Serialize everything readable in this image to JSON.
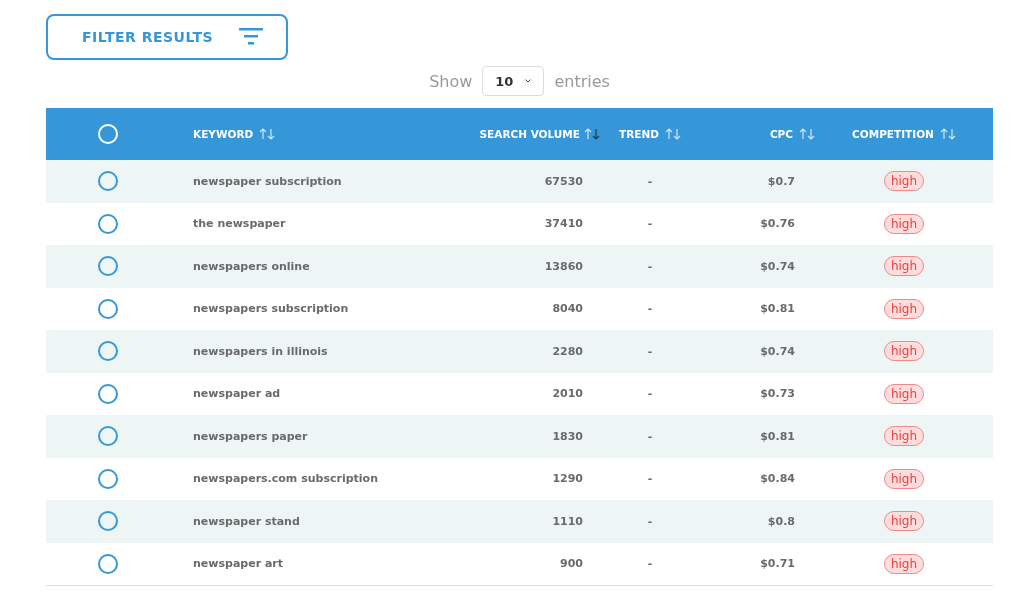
{
  "filter_button": {
    "label": "FILTER RESULTS"
  },
  "entries": {
    "prefix": "Show",
    "value": "10",
    "suffix": "entries"
  },
  "table": {
    "select_all": {
      "checked": false
    },
    "columns": [
      {
        "label": "KEYWORD",
        "sorted": false
      },
      {
        "label": "SEARCH VOLUME",
        "sorted": true
      },
      {
        "label": "TREND",
        "sorted": false
      },
      {
        "label": "CPC",
        "sorted": false
      },
      {
        "label": "COMPETITION",
        "sorted": false
      }
    ],
    "rows": [
      {
        "checked": false,
        "keyword": "newspaper subscription",
        "volume": "67530",
        "trend": "-",
        "cpc": "$0.7",
        "competition": "high"
      },
      {
        "checked": false,
        "keyword": "the newspaper",
        "volume": "37410",
        "trend": "-",
        "cpc": "$0.76",
        "competition": "high"
      },
      {
        "checked": false,
        "keyword": "newspapers online",
        "volume": "13860",
        "trend": "-",
        "cpc": "$0.74",
        "competition": "high"
      },
      {
        "checked": false,
        "keyword": "newspapers subscription",
        "volume": "8040",
        "trend": "-",
        "cpc": "$0.81",
        "competition": "high"
      },
      {
        "checked": false,
        "keyword": "newspapers in illinois",
        "volume": "2280",
        "trend": "-",
        "cpc": "$0.74",
        "competition": "high"
      },
      {
        "checked": false,
        "keyword": "newspaper ad",
        "volume": "2010",
        "trend": "-",
        "cpc": "$0.73",
        "competition": "high"
      },
      {
        "checked": false,
        "keyword": "newspapers paper",
        "volume": "1830",
        "trend": "-",
        "cpc": "$0.81",
        "competition": "high"
      },
      {
        "checked": false,
        "keyword": "newspapers.com subscription",
        "volume": "1290",
        "trend": "-",
        "cpc": "$0.84",
        "competition": "high"
      },
      {
        "checked": false,
        "keyword": "newspaper stand",
        "volume": "1110",
        "trend": "-",
        "cpc": "$0.8",
        "competition": "high"
      },
      {
        "checked": false,
        "keyword": "newspaper art",
        "volume": "900",
        "trend": "-",
        "cpc": "$0.71",
        "competition": "high"
      }
    ]
  }
}
